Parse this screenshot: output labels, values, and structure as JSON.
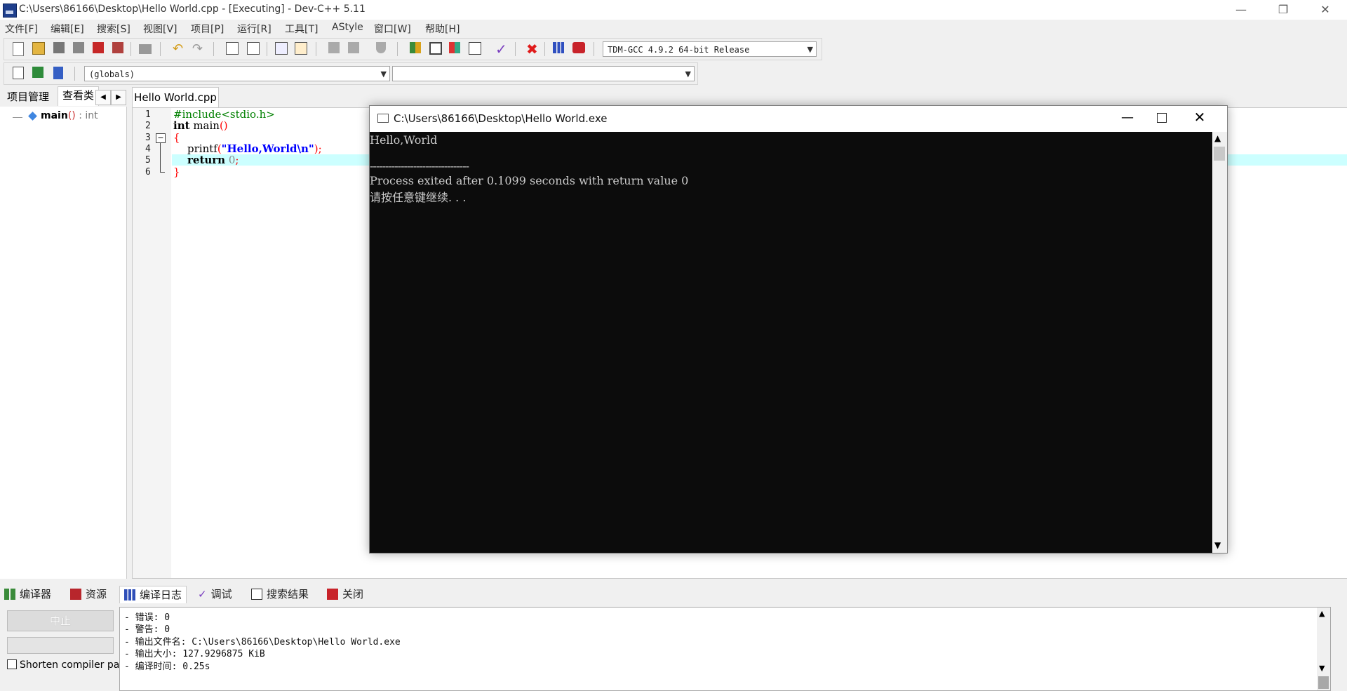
{
  "window": {
    "title": "C:\\Users\\86166\\Desktop\\Hello World.cpp - [Executing] - Dev-C++ 5.11",
    "controls": [
      "—",
      "❐",
      "✕"
    ]
  },
  "menu": [
    "文件[F]",
    "编辑[E]",
    "搜索[S]",
    "视图[V]",
    "项目[P]",
    "运行[R]",
    "工具[T]",
    "AStyle",
    "窗口[W]",
    "帮助[H]"
  ],
  "toolbar": {
    "compiler_select": "TDM-GCC 4.9.2 64-bit Release",
    "scope_select": "(globals)",
    "function_select": ""
  },
  "left_panel": {
    "tabs": [
      "项目管理",
      "查看类"
    ],
    "tree_item": {
      "name": "main",
      "args": "()",
      "type": ": int"
    }
  },
  "editor": {
    "tab": "Hello World.cpp",
    "line_numbers": [
      "1",
      "2",
      "3",
      "4",
      "5",
      "6"
    ],
    "lines": [
      {
        "text": "#include<stdio.h>"
      },
      {
        "kw": "int",
        "rest": " main",
        "paren": "()"
      },
      {
        "brace": "{"
      },
      {
        "fn": "printf",
        "open": "(",
        "str": "\"Hello,World\\n\"",
        "close": ");"
      },
      {
        "kw": "return",
        "num": " 0",
        "semi": ";"
      },
      {
        "brace": "}"
      }
    ],
    "fold_marker": "−"
  },
  "console": {
    "title": "C:\\Users\\86166\\Desktop\\Hello World.exe",
    "lines": [
      "Hello,World",
      "",
      "--------------------------------",
      "Process exited after 0.1099 seconds with return value 0",
      "请按任意键继续. . ."
    ]
  },
  "bottom_panel": {
    "tabs": [
      "编译器",
      "资源",
      "编译日志",
      "调试",
      "搜索结果",
      "关闭"
    ],
    "abort_button": "中止",
    "shorten_checkbox": "Shorten compiler pa",
    "log_lines": [
      "- 错误: 0",
      "- 警告: 0",
      "- 输出文件名: C:\\Users\\86166\\Desktop\\Hello World.exe",
      "- 输出大小: 127.9296875 KiB",
      "- 编译时间: 0.25s"
    ]
  },
  "colors": {
    "editor_highlight": "#ccffff",
    "keyword": "#000000",
    "string": "#0000ff",
    "symbol": "#ff0000",
    "preprocessor": "#008000",
    "console_bg": "#0c0c0c",
    "console_fg": "#cccccc"
  }
}
